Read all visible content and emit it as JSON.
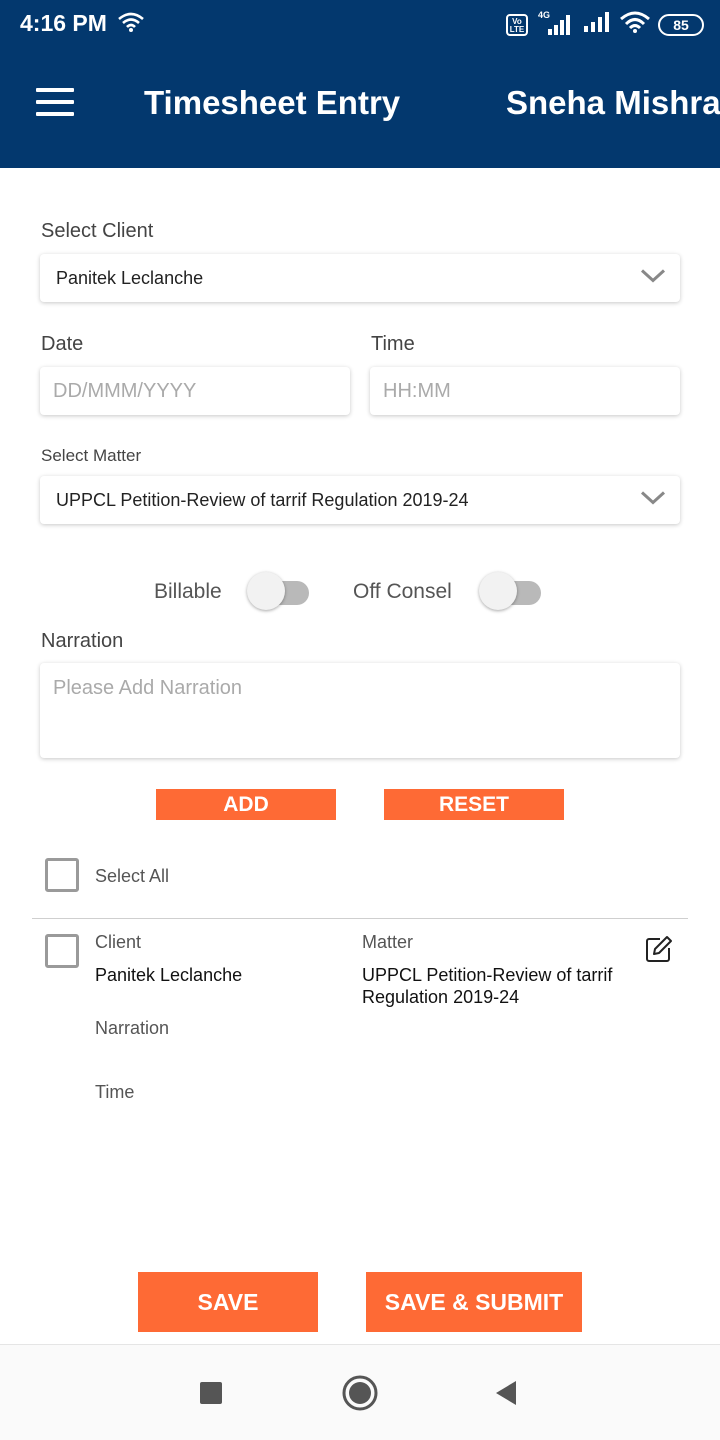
{
  "status_bar": {
    "time": "4:16 PM",
    "volte": "Vo LTE",
    "network": "4G",
    "battery": "85"
  },
  "header": {
    "title": "Timesheet Entry",
    "user_name": "Sneha Mishra",
    "menu_icon": "hamburger-menu-icon"
  },
  "form": {
    "client": {
      "label": "Select Client",
      "value": "Panitek Leclanche"
    },
    "date": {
      "label": "Date",
      "placeholder": "DD/MMM/YYYY"
    },
    "time": {
      "label": "Time",
      "placeholder": "HH:MM"
    },
    "matter": {
      "label": "Select Matter",
      "value": "UPPCL Petition-Review of tarrif Regulation 2019-24"
    },
    "billable": {
      "label": "Billable",
      "on": false
    },
    "off_consel": {
      "label": "Off Consel",
      "on": false
    },
    "narration": {
      "label": "Narration",
      "placeholder": "Please Add Narration"
    },
    "add_label": "ADD",
    "reset_label": "RESET"
  },
  "list": {
    "select_all_label": "Select All",
    "entries": [
      {
        "client_label": "Client",
        "client_value": "Panitek Leclanche",
        "matter_label": "Matter",
        "matter_value": "UPPCL Petition-Review of tarrif Regulation 2019-24",
        "narration_label": "Narration",
        "time_label": "Time",
        "edit_icon": "edit-icon"
      }
    ]
  },
  "footer": {
    "save_label": "SAVE",
    "save_submit_label": "SAVE & SUBMIT"
  },
  "colors": {
    "header_bg": "#03386e",
    "accent": "#fe6a35"
  }
}
